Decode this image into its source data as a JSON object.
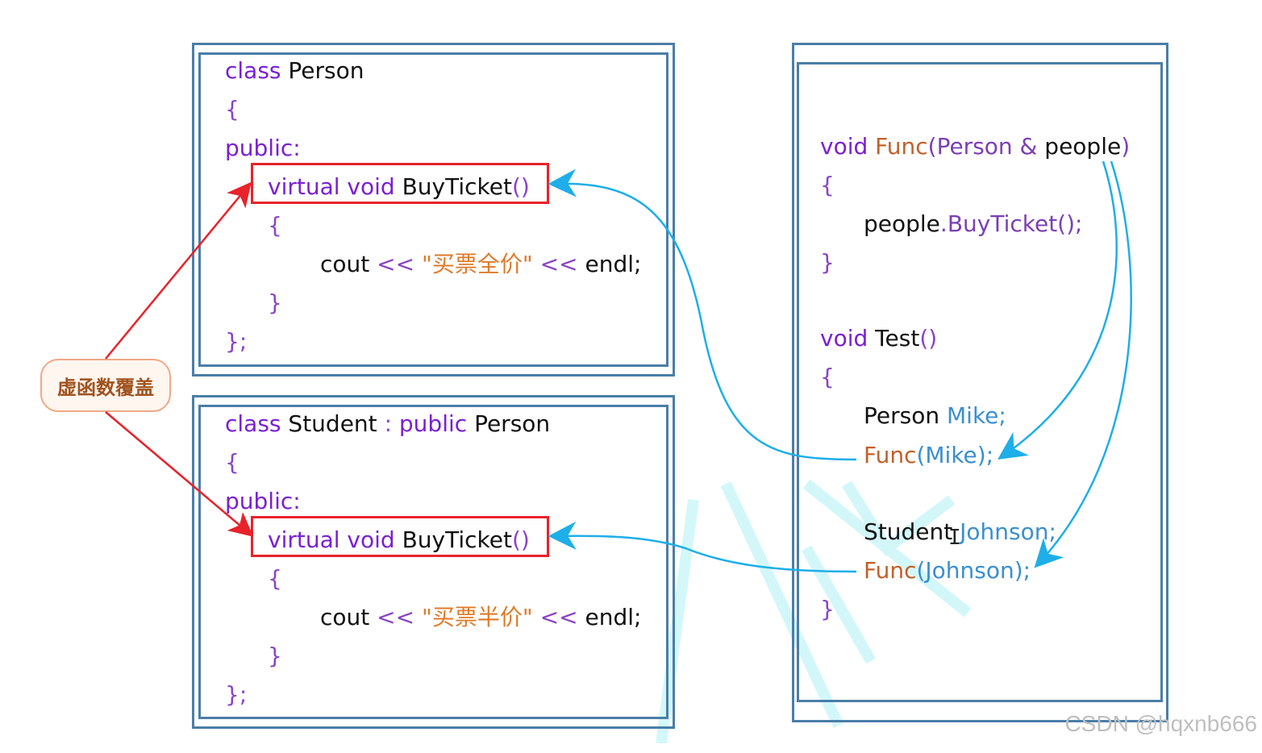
{
  "badge": {
    "label": "虚函数覆盖"
  },
  "person_box": {
    "lines": {
      "l1_kw": "class",
      "l1_name": "Person",
      "l2": "{",
      "l3": "public:",
      "l4_kw": "virtual void",
      "l4_fn": "BuyTicket",
      "l4_paren": "()",
      "l5": "{",
      "l6_cout": "cout",
      "l6_op1": "<<",
      "l6_str": "\"买票全价\"",
      "l6_op2": "<<",
      "l6_endl": "endl;",
      "l7": "}",
      "l8": "};"
    }
  },
  "student_box": {
    "lines": {
      "l1_kw": "class",
      "l1_name": "Student",
      "l1_colon": ":",
      "l1_pub": "public",
      "l1_base": "Person",
      "l2": "{",
      "l3": "public:",
      "l4_kw": "virtual void",
      "l4_fn": "BuyTicket",
      "l4_paren": "()",
      "l5": "{",
      "l6_cout": "cout",
      "l6_op1": "<<",
      "l6_str": "\"买票半价\"",
      "l6_op2": "<<",
      "l6_endl": "endl;",
      "l7": "}",
      "l8": "};"
    }
  },
  "right_box": {
    "lines": {
      "f1_void": "void",
      "f1_name": "Func",
      "f1_params": "(Person &",
      "f1_people": "people",
      "f1_close": ")",
      "f2": "{",
      "f3_obj": "people",
      "f3_call": ".BuyTicket();",
      "f4": "}",
      "t1_void": "void",
      "t1_name": "Test",
      "t1_paren": "()",
      "t2": "{",
      "t3_type": "Person",
      "t3_var": "Mike;",
      "t4_fn": "Func",
      "t4_arg": "(Mike);",
      "t5_type": "Student",
      "t5_var": "Johnson;",
      "t6_fn": "Func",
      "t6_arg": "(Johnson);",
      "t7": "}"
    }
  },
  "watermark": "CSDN @hqxnb666",
  "colors": {
    "frame": "#4a7ea8",
    "highlight": "#e8232b",
    "arrow_blue": "#1eaee8",
    "arrow_red": "#e8232b",
    "keyword": "#7a1fd6",
    "string": "#e07a28"
  }
}
